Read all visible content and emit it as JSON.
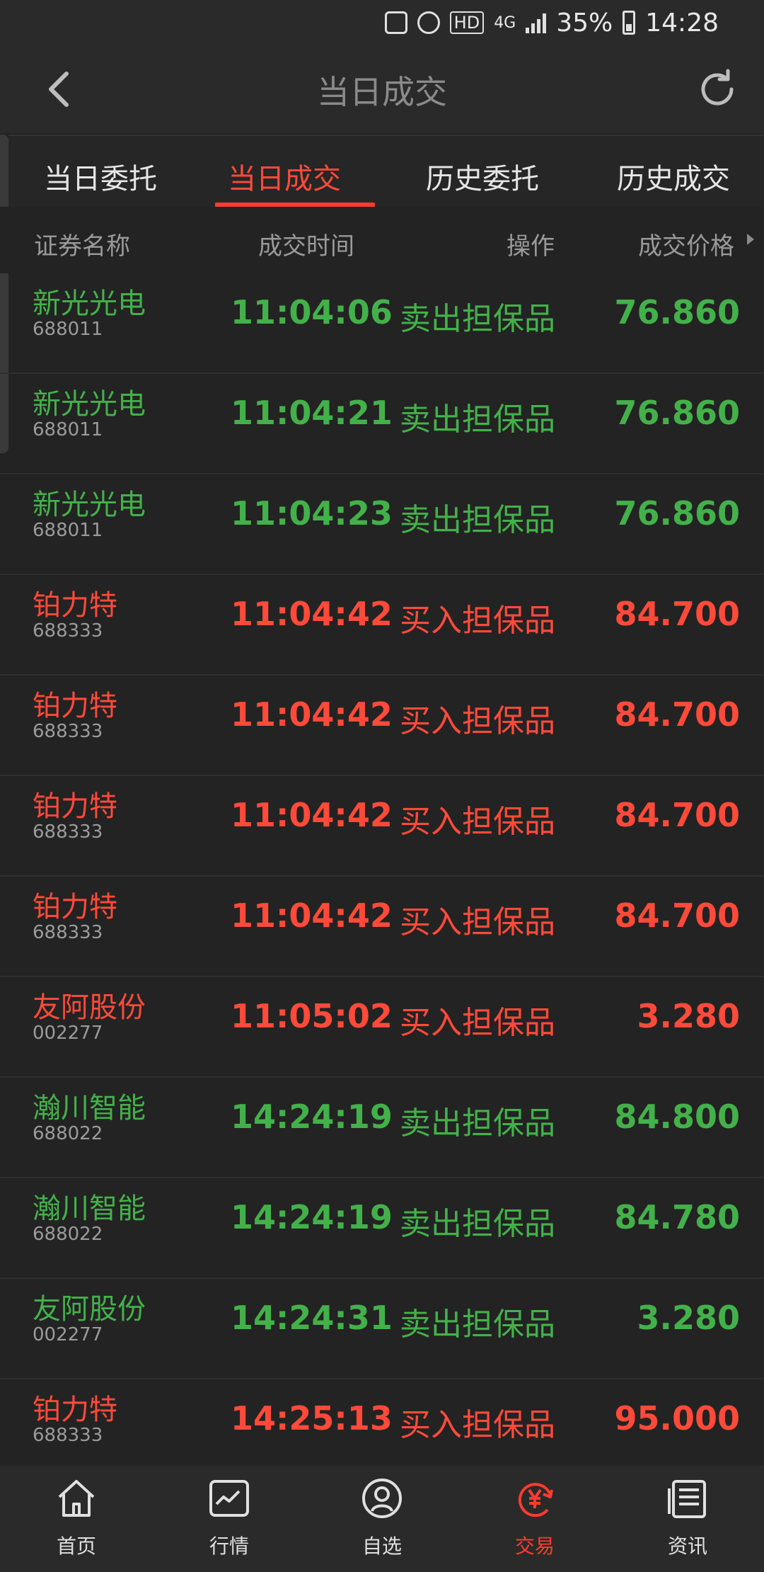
{
  "status_bar": {
    "battery_percent": "35%",
    "time": "14:28",
    "network": "4G",
    "hd": "HD"
  },
  "header": {
    "title": "当日成交"
  },
  "tabs": [
    {
      "label": "当日委托"
    },
    {
      "label": "当日成交"
    },
    {
      "label": "历史委托"
    },
    {
      "label": "历史成交"
    }
  ],
  "table": {
    "columns": [
      "证券名称",
      "成交时间",
      "操作",
      "成交价格"
    ],
    "rows": [
      {
        "name": "新光光电",
        "code": "688011",
        "time": "11:04:06",
        "op": "卖出担保品",
        "price": "76.860",
        "side": "sell"
      },
      {
        "name": "新光光电",
        "code": "688011",
        "time": "11:04:21",
        "op": "卖出担保品",
        "price": "76.860",
        "side": "sell"
      },
      {
        "name": "新光光电",
        "code": "688011",
        "time": "11:04:23",
        "op": "卖出担保品",
        "price": "76.860",
        "side": "sell"
      },
      {
        "name": "铂力特",
        "code": "688333",
        "time": "11:04:42",
        "op": "买入担保品",
        "price": "84.700",
        "side": "buy"
      },
      {
        "name": "铂力特",
        "code": "688333",
        "time": "11:04:42",
        "op": "买入担保品",
        "price": "84.700",
        "side": "buy"
      },
      {
        "name": "铂力特",
        "code": "688333",
        "time": "11:04:42",
        "op": "买入担保品",
        "price": "84.700",
        "side": "buy"
      },
      {
        "name": "铂力特",
        "code": "688333",
        "time": "11:04:42",
        "op": "买入担保品",
        "price": "84.700",
        "side": "buy"
      },
      {
        "name": "友阿股份",
        "code": "002277",
        "time": "11:05:02",
        "op": "买入担保品",
        "price": "3.280",
        "side": "buy"
      },
      {
        "name": "瀚川智能",
        "code": "688022",
        "time": "14:24:19",
        "op": "卖出担保品",
        "price": "84.800",
        "side": "sell"
      },
      {
        "name": "瀚川智能",
        "code": "688022",
        "time": "14:24:19",
        "op": "卖出担保品",
        "price": "84.780",
        "side": "sell"
      },
      {
        "name": "友阿股份",
        "code": "002277",
        "time": "14:24:31",
        "op": "卖出担保品",
        "price": "3.280",
        "side": "sell"
      },
      {
        "name": "铂力特",
        "code": "688333",
        "time": "14:25:13",
        "op": "买入担保品",
        "price": "95.000",
        "side": "buy"
      }
    ]
  },
  "bottom_nav": [
    {
      "label": "首页",
      "icon": "home-icon"
    },
    {
      "label": "行情",
      "icon": "market-chart-icon"
    },
    {
      "label": "自选",
      "icon": "watchlist-user-icon"
    },
    {
      "label": "交易",
      "icon": "trade-yen-icon"
    },
    {
      "label": "资讯",
      "icon": "news-document-icon"
    }
  ],
  "colors": {
    "buy": "#ff4a3a",
    "sell": "#43b14a",
    "accent": "#ff3b2f",
    "background": "#232323"
  }
}
